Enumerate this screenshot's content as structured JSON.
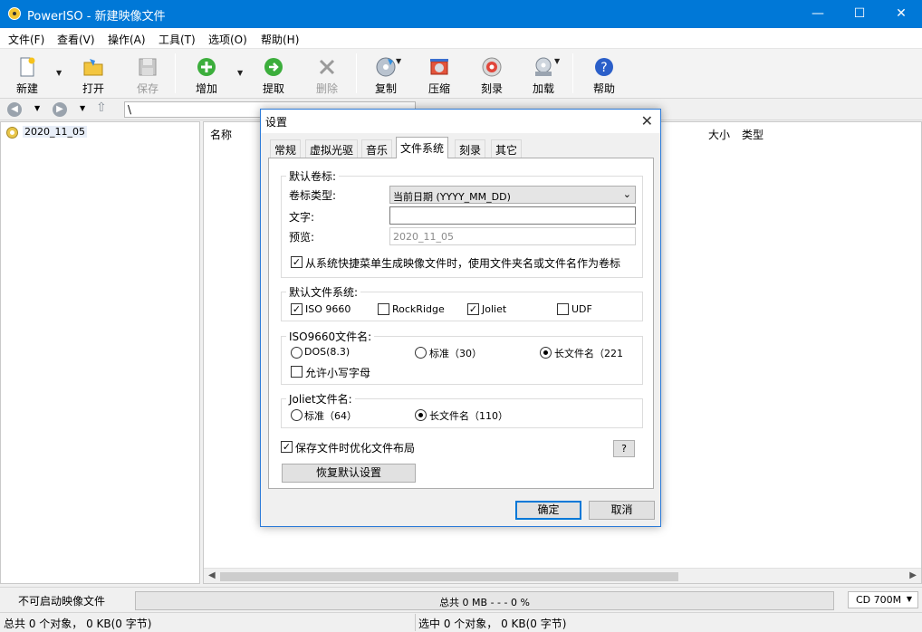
{
  "window": {
    "title": "PowerISO - 新建映像文件",
    "minimize": "—",
    "maximize": "☐",
    "close": "✕"
  },
  "menu": [
    "文件(F)",
    "查看(V)",
    "操作(A)",
    "工具(T)",
    "选项(O)",
    "帮助(H)"
  ],
  "toolbar": {
    "new": "新建",
    "open": "打开",
    "save": "保存",
    "add": "增加",
    "extract": "提取",
    "delete": "删除",
    "copy": "复制",
    "compress": "压缩",
    "burn": "刻录",
    "mount": "加载",
    "help": "帮助"
  },
  "address": {
    "path": "\\"
  },
  "tree": {
    "root": "2020_11_05"
  },
  "filelist": {
    "columns": {
      "name": "名称",
      "size": "大小",
      "type": "类型"
    }
  },
  "status": {
    "boot": "不可启动映像文件",
    "progress_text": "总共  0 MB   - - -  0 %",
    "progress_fraction": 0,
    "disc": "CD 700M",
    "total": "总共 0 个对象， 0 KB(0 字节)",
    "selected": "选中 0 个对象， 0 KB(0 字节)"
  },
  "dialog": {
    "title": "设置",
    "tabs": [
      "常规",
      "虚拟光驱",
      "音乐",
      "文件系统",
      "刻录",
      "其它"
    ],
    "active_tab": "文件系统",
    "volume": {
      "legend": "默认卷标:",
      "type_label": "卷标类型:",
      "type_value": "当前日期 (YYYY_MM_DD)",
      "text_label": "文字:",
      "text_value": "",
      "preview_label": "预览:",
      "preview_value": "2020_11_05",
      "use_folder_name": "从系统快捷菜单生成映像文件时，使用文件夹名或文件名作为卷标",
      "use_folder_name_checked": true
    },
    "filesystem": {
      "legend": "默认文件系统:",
      "iso9660": "ISO 9660",
      "iso9660_checked": true,
      "rockridge": "RockRidge",
      "rockridge_checked": false,
      "joliet": "Joliet",
      "joliet_checked": true,
      "udf": "UDF",
      "udf_checked": false
    },
    "iso_names": {
      "legend": "ISO9660文件名:",
      "dos": "DOS(8.3)",
      "standard": "标准（30）",
      "long": "长文件名（221",
      "selected": "long",
      "lowercase": "允许小写字母",
      "lowercase_checked": false
    },
    "joliet_names": {
      "legend": "Joliet文件名:",
      "standard": "标准（64）",
      "long": "长文件名（110）",
      "selected": "long"
    },
    "optimize": "保存文件时优化文件布局",
    "optimize_checked": true,
    "help_button": "?",
    "restore_defaults": "恢复默认设置",
    "ok": "确定",
    "cancel": "取消"
  }
}
